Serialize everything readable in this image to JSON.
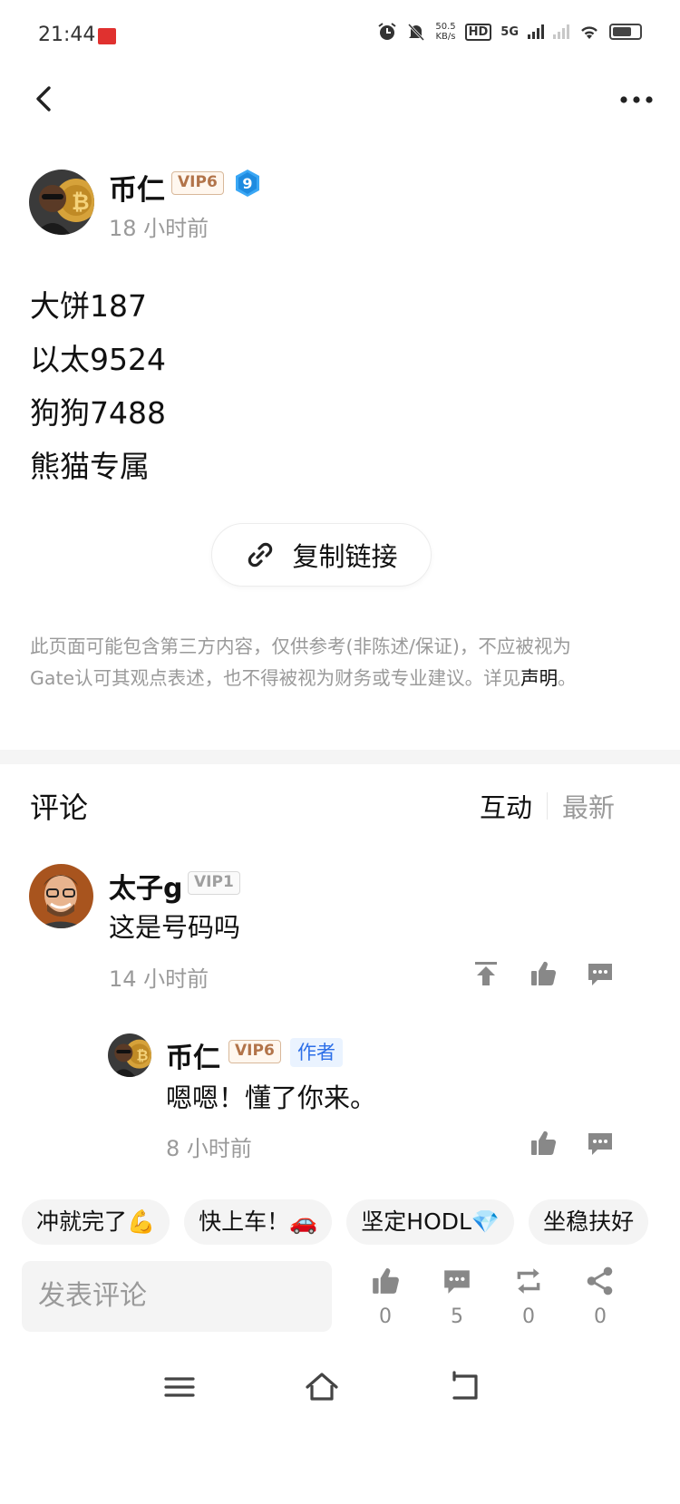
{
  "status_bar": {
    "time": "21:44",
    "speed_value": "50.5",
    "speed_unit": "KB/s",
    "hd": "HD",
    "network": "5G"
  },
  "post": {
    "author": {
      "name": "币仁",
      "vip": "VIP6",
      "level": "9",
      "time": "18 小时前"
    },
    "lines": [
      "大饼187",
      "以太9524",
      "狗狗7488",
      "熊猫专属"
    ],
    "copy_link": "复制链接",
    "disclaimer_main": "此页面可能包含第三方内容，仅供参考(非陈述/保证)，不应被视为Gate认可其观点表述，也不得被视为财务或专业建议。详见",
    "disclaimer_link": "声明",
    "disclaimer_end": "。"
  },
  "comments": {
    "title": "评论",
    "sort_active": "互动",
    "sort_inactive": "最新",
    "items": [
      {
        "name": "太子g",
        "vip": "VIP1",
        "text": "这是号码吗",
        "time": "14 小时前"
      }
    ],
    "reply": {
      "name": "币仁",
      "vip": "VIP6",
      "tag": "作者",
      "text": "嗯嗯！懂了你来。",
      "time": "8 小时前"
    }
  },
  "quick_replies": [
    "冲就完了💪",
    "快上车！🚗",
    "坚定HODL💎",
    "坐稳扶好"
  ],
  "bottom_bar": {
    "input_placeholder": "发表评论",
    "likes": "0",
    "comments": "5",
    "reposts": "0",
    "shares": "0"
  },
  "colors": {
    "vip_gold": "#b2744a",
    "author_tag_blue": "#2d6fe8",
    "muted_text": "#9a9a9a",
    "icon_gray": "#888888"
  }
}
